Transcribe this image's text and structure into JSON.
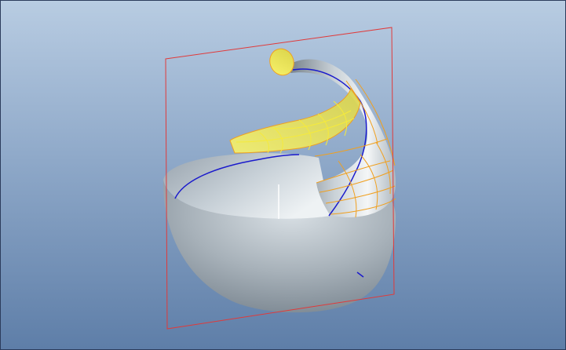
{
  "viewport": {
    "background_top": "#b8cce2",
    "background_bottom": "#5e7ea8"
  },
  "scene": {
    "datum_plane": {
      "color": "#e03a3a",
      "highlighted": false
    },
    "selected_surface": {
      "color": "#f0ec5a",
      "highlight_edges": "#f0a020"
    },
    "datum_curve": {
      "color": "#1a1acc"
    },
    "model_color": "#a9b3bb",
    "handle_icon": "tick-mark-icon"
  }
}
